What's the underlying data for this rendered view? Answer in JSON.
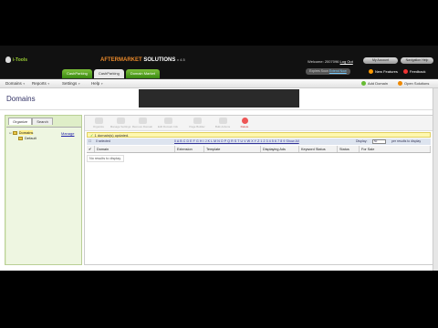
{
  "header": {
    "logo_text": "i-Tools",
    "brand_prefix": "AFTERMARKET",
    "brand_suffix": "SOLUTIONS",
    "version": "v 4.5",
    "welcome_text": "Welcome: 2007096",
    "logout": "Log Out",
    "pill_my_account": "My Account",
    "pill_help": "Navigation Help",
    "expire_text": "Expires Soon",
    "expire_link": "Extend Now",
    "new_features": "New Features",
    "feedback": "Feedback"
  },
  "top_tabs": [
    "CashParking",
    "CashParking",
    "Domain Market"
  ],
  "menu": {
    "items": [
      "Domains",
      "Reports",
      "Settings",
      "Help"
    ],
    "add_domain": "Add Domain",
    "open_solutions": "Open Solutions"
  },
  "page": {
    "title": "Domains"
  },
  "left_panel": {
    "tabs": [
      "Organize",
      "Search"
    ],
    "tree": [
      "Domains",
      "Default"
    ],
    "manage_link": "Manage"
  },
  "toolbar": {
    "buttons": [
      "Organize",
      "Manage Settings",
      "Remove Domain",
      "Edit Domain Info",
      "Page Builder",
      "Bulk Actions",
      "Delete"
    ]
  },
  "notice": "1 domain(s) updated.",
  "filter": {
    "domain_label": "0 selected",
    "letters": "0 A B C D E F G H I J K L M N O P Q R S T U V W X Y Z 1 2 3 4 5 6 7 8 9 Show All",
    "display_label": "Display:",
    "per_page": "50",
    "per_suffix": "per results to display"
  },
  "table": {
    "columns": [
      "Domain",
      "Extension",
      "Template",
      "Displaying Ads",
      "Keyword Status",
      "Status",
      "For Sale"
    ],
    "empty": "No results to display."
  }
}
